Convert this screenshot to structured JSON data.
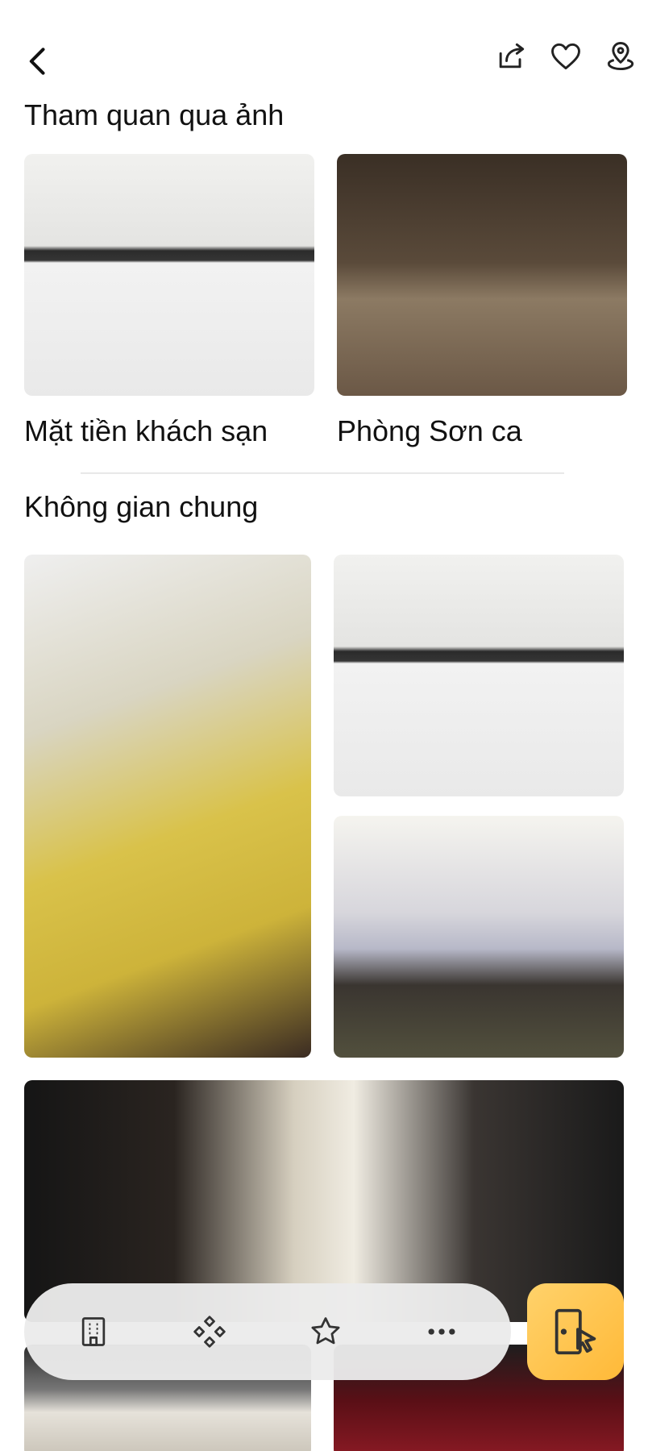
{
  "header": {
    "back_icon": "chevron-left-icon",
    "share_icon": "share-icon",
    "favorite_icon": "heart-icon",
    "location_icon": "map-pin-icon"
  },
  "tour": {
    "title": "Tham quan qua ảnh",
    "items": [
      {
        "caption": "Mặt tiền khách sạn"
      },
      {
        "caption": "Phòng Sơn ca"
      }
    ]
  },
  "common": {
    "title": "Không gian chung"
  },
  "bottom_nav": {
    "items": [
      {
        "icon": "building-icon"
      },
      {
        "icon": "grid-diamonds-icon"
      },
      {
        "icon": "star-icon"
      },
      {
        "icon": "more-icon"
      }
    ],
    "cta_icon": "door-click-icon",
    "cta_color": "#FFB938"
  }
}
